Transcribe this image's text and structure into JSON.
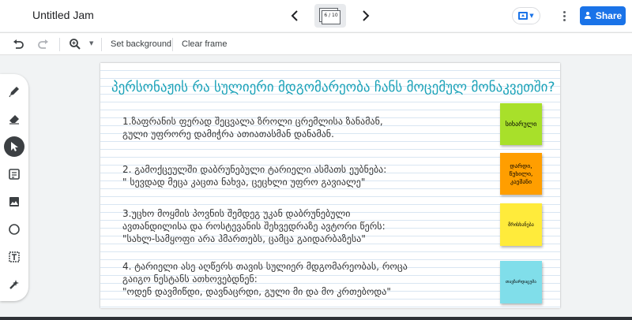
{
  "header": {
    "title": "Untitled Jam",
    "frame_counter": "6 / 10",
    "share_label": "Share"
  },
  "toolbar": {
    "set_background": "Set background",
    "clear_frame": "Clear frame"
  },
  "frame": {
    "heading": "პერსონაჟის რა სულიერი მდგომარეობა ჩანს მოცემულ მონაკვეთში?",
    "items": [
      {
        "line1": "1.ზაფრანის ფერად შეცვალა ზროლი ცრემლისა ზანამან,",
        "line2": "გული უფრორე დამიჭრა ათიათასმან დანამან."
      },
      {
        "line1": "2. გამოქცეულში დაბრუნებული ტარიელი ასმათს ეუბნება:",
        "line2": "\" სევდად მეცა კაცთა ნახვა, ცეცხლი უფრო გავიალე\""
      },
      {
        "line1": "3.უცხო მოყმის პოვნის შემდეგ უკან დაბრუნებული",
        "line2": "ავთანდილისა და როსტევანის შეხვედრაზე ავტორი წერს:",
        "line3": "\"სახლ-სამყოფი არა ჰმართებს, ცამცა გაიდარბაზესა\""
      },
      {
        "line1": "4. ტარიელი ასე აღწერს თავის სულიერ მდგომარეობას, როცა",
        "line2": "გაიგო ნესტანს ათხოვებდნენ:",
        "line3": "\"ოდენ დავმიწდი, დავნაცრდი, გული მი და მო კრთებოდა\""
      }
    ],
    "stickies": [
      {
        "text": "სიხარული",
        "color": "#a8e02a"
      },
      {
        "text": "დარდი, წუხილი, კაეშანი",
        "color": "#ff9e00"
      },
      {
        "text": "მრისხანება",
        "color": "#ffeb3b"
      },
      {
        "text": "თავზარდაცემა",
        "color": "#80deea"
      }
    ]
  },
  "icons": {
    "prev": "chevron-left-icon",
    "next": "chevron-right-icon",
    "undo": "undo-icon",
    "redo": "redo-icon",
    "zoom": "zoom-icon",
    "pen": "pen-icon",
    "eraser": "eraser-icon",
    "select": "cursor-icon",
    "note": "sticky-note-icon",
    "image": "image-icon",
    "circle": "circle-icon",
    "textbox": "text-box-icon",
    "laser": "laser-icon"
  },
  "colors": {
    "accent": "#1a73e8",
    "heading": "#1aa2b8"
  }
}
